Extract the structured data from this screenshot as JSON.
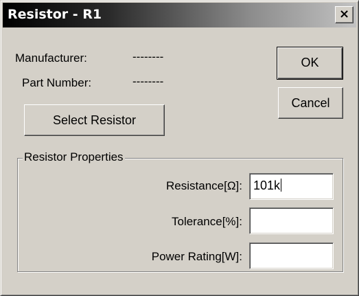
{
  "window": {
    "title": "Resistor - R1",
    "close_glyph": "×"
  },
  "info": {
    "manufacturer_label": "Manufacturer:",
    "manufacturer_value": "--------",
    "part_number_label": "Part Number:",
    "part_number_value": "--------"
  },
  "buttons": {
    "ok": "OK",
    "cancel": "Cancel",
    "select_resistor": "Select Resistor"
  },
  "properties": {
    "group_title": "Resistor Properties",
    "resistance_label": "Resistance[Ω]:",
    "resistance_value": "101k",
    "tolerance_label": "Tolerance[%]:",
    "tolerance_value": "",
    "power_label": "Power Rating[W]:",
    "power_value": ""
  }
}
